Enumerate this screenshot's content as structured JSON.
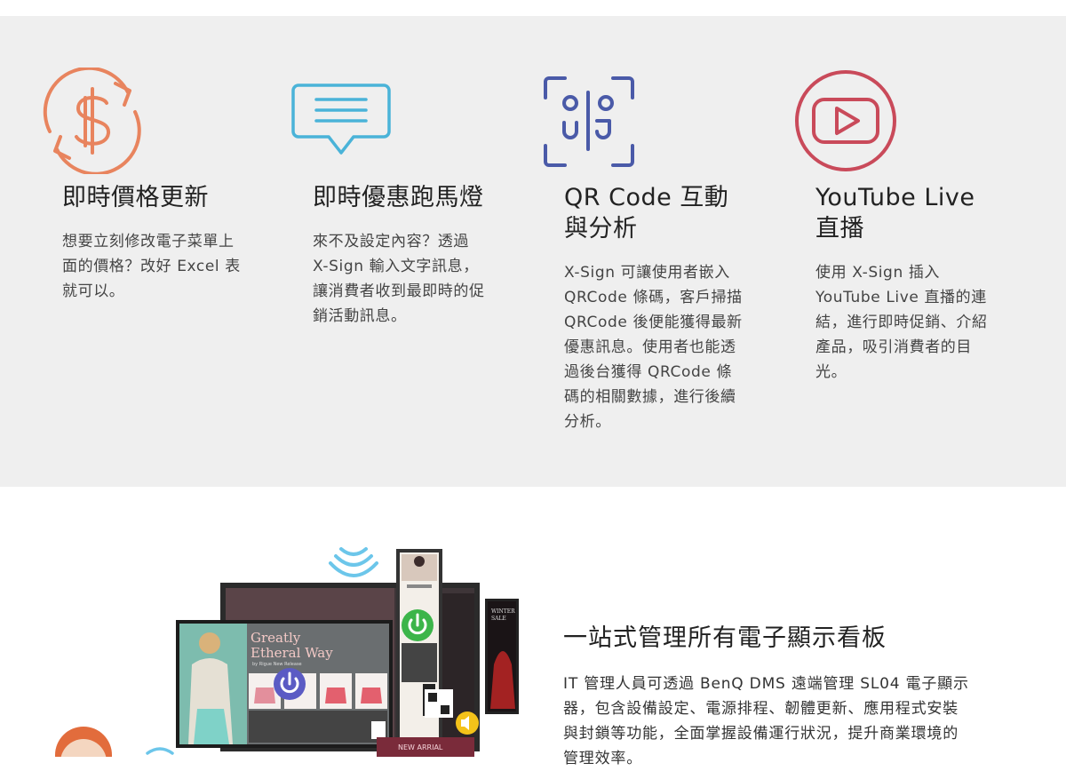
{
  "features": [
    {
      "icon": "price-refresh-icon",
      "color": "#e8845e",
      "title": "即時價格更新",
      "desc": "想要立刻修改電子菜單上\n面的價格？改好 Excel 表\n就可以。"
    },
    {
      "icon": "message-banner-icon",
      "color": "#4ab3d8",
      "title": "即時優惠跑馬燈",
      "desc": "來不及設定內容？透過\nX-Sign 輸入文字訊息，\n讓消費者收到最即時的促\n銷活動訊息。"
    },
    {
      "icon": "qr-scan-icon",
      "color": "#4a5aa8",
      "title": "QR Code 互動\n與分析",
      "desc": "X-Sign 可讓使用者嵌入\nQRCode 條碼，客戶掃描\nQRCode 後便能獲得最新\n優惠訊息。使用者也能透\n過後台獲得 QRCode 條\n碼的相關數據，進行後續\n分析。"
    },
    {
      "icon": "youtube-play-icon",
      "color": "#c94a5a",
      "title": "YouTube Live\n直播",
      "desc": "使用 X-Sign 插入\nYouTube Live 直播的連\n結，進行即時促銷、介紹\n產品，吸引消費者的目\n光。"
    }
  ],
  "illustration": {
    "screen_headline": "Greatly\nEtheral Way",
    "screen_sub": "by Rigue New Release",
    "side_banner": "WINTER\nSALE",
    "bottom_banner": "NEW ARRIAL"
  },
  "management": {
    "title": "一站式管理所有電子顯示看板",
    "desc": "IT 管理人員可透過 BenQ DMS 遠端管理 SL04 電子顯示\n器，包含設備設定、電源排程、韌體更新、應用程式安裝\n與封鎖等功能，全面掌握設備運行狀況，提升商業環境的\n管理效率。"
  }
}
